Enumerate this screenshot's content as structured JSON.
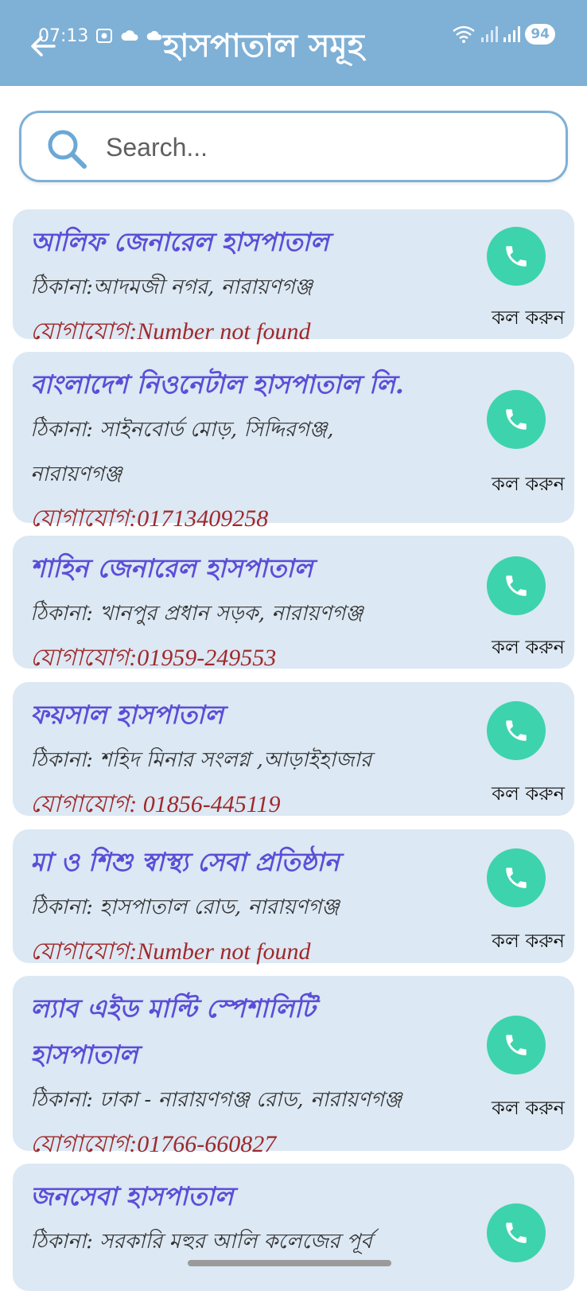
{
  "status_bar": {
    "time": "07:13",
    "battery": "94"
  },
  "header": {
    "title": "হাসপাতাল সমূহ"
  },
  "search": {
    "placeholder": "Search..."
  },
  "call_label": "কল করুন",
  "hospitals": [
    {
      "name": "আলিফ জেনারেল হাসপাতাল",
      "address": "ঠিকানা:আদমজী নগর, নারায়ণগঞ্জ",
      "contact": "যোগাযোগ:Number not found"
    },
    {
      "name": "বাংলাদেশ নিওনেটাল হাসপাতাল লি.",
      "address": "ঠিকানা: সাইনবোর্ড মোড়, সিদ্দিরগঞ্জ, নারায়ণগঞ্জ",
      "contact": "যোগাযোগ:01713409258"
    },
    {
      "name": "শাহিন জেনারেল হাসপাতাল",
      "address": "ঠিকানা: খানপুর প্রধান সড়ক, নারায়ণগঞ্জ",
      "contact": "যোগাযোগ:01959-249553"
    },
    {
      "name": "ফয়সাল হাসপাতাল",
      "address": "ঠিকানা: শহিদ মিনার সংলগ্ন ,আড়াইহাজার",
      "contact": "যোগাযোগ: 01856-445119"
    },
    {
      "name": "মা ও শিশু স্বাস্থ্য সেবা প্রতিষ্ঠান",
      "address": "ঠিকানা: হাসপাতাল রোড, নারায়ণগঞ্জ",
      "contact": "যোগাযোগ:Number not found"
    },
    {
      "name": "ল্যাব এইড মাল্টি স্পেশালিটি হাসপাতাল",
      "address": "ঠিকানা: ঢাকা - নারায়ণগঞ্জ রোড, নারায়ণগঞ্জ",
      "contact": "যোগাযোগ:01766-660827"
    },
    {
      "name": "জনসেবা হাসপাতাল",
      "address": "ঠিকানা: সরকারি মহুর আলি কলেজের পূর্ব",
      "contact": ""
    }
  ],
  "colors": {
    "appbar": "#7fb0d6",
    "card_bg": "#dce8f3",
    "name_text": "#5a4ed8",
    "contact_text": "#a0282a",
    "call_button": "#3dd3ad"
  }
}
